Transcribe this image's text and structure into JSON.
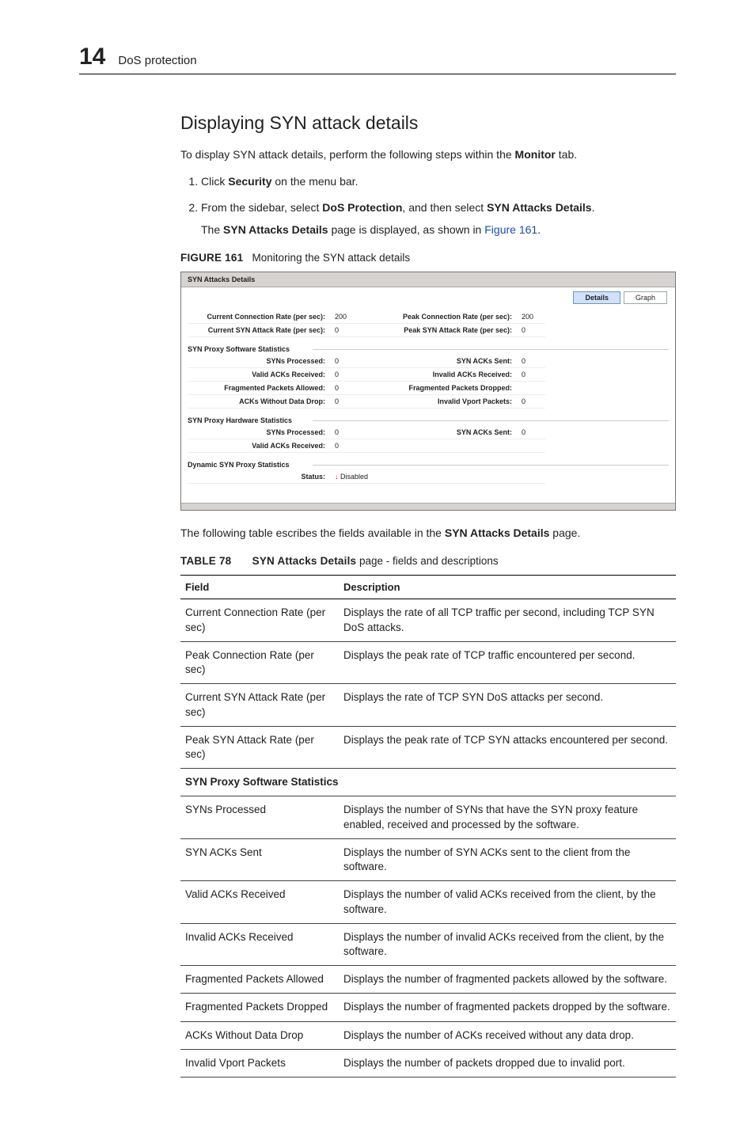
{
  "header": {
    "chapter_number": "14",
    "chapter_title": "DoS protection"
  },
  "section_title": "Displaying SYN attack details",
  "intro": {
    "pre": "To display SYN attack details, perform the following steps within the ",
    "bold": "Monitor",
    "post": " tab."
  },
  "steps": [
    {
      "pre": "Click ",
      "b1": "Security",
      "post": " on the menu bar."
    },
    {
      "pre": "From the sidebar, select ",
      "b1": "DoS Protection",
      "mid": ", and then select ",
      "b2": "SYN Attacks Details",
      "post": ".",
      "result_pre": "The ",
      "result_b": "SYN Attacks Details",
      "result_mid": " page is displayed, as shown in ",
      "result_link": "Figure 161",
      "result_post": "."
    }
  ],
  "figure": {
    "label": "FIGURE 161",
    "title": "Monitoring the SYN attack details"
  },
  "mock": {
    "title": "SYN Attacks Details",
    "tabs": {
      "details": "Details",
      "graph": "Graph"
    },
    "top_rows": [
      {
        "l1": "Current Connection Rate (per sec):",
        "v1": "200",
        "l2": "Peak Connection Rate (per sec):",
        "v2": "200"
      },
      {
        "l1": "Current SYN Attack Rate (per sec):",
        "v1": "0",
        "l2": "Peak SYN Attack Rate (per sec):",
        "v2": "0"
      }
    ],
    "group_soft": "SYN Proxy Software Statistics",
    "soft_rows": [
      {
        "l1": "SYNs Processed:",
        "v1": "0",
        "l2": "SYN ACKs Sent:",
        "v2": "0"
      },
      {
        "l1": "Valid ACKs Received:",
        "v1": "0",
        "l2": "Invalid ACKs Received:",
        "v2": "0"
      },
      {
        "l1": "Fragmented Packets Allowed:",
        "v1": "0",
        "l2": "Fragmented Packets Dropped:",
        "v2": ""
      },
      {
        "l1": "ACKs Without Data Drop:",
        "v1": "0",
        "l2": "Invalid Vport Packets:",
        "v2": "0"
      }
    ],
    "group_hard": "SYN Proxy Hardware Statistics",
    "hard_rows": [
      {
        "l1": "SYNs Processed:",
        "v1": "0",
        "l2": "SYN ACKs Sent:",
        "v2": "0"
      },
      {
        "l1": "Valid ACKs Received:",
        "v1": "0",
        "l2": "",
        "v2": ""
      }
    ],
    "group_dyn": "Dynamic SYN Proxy Statistics",
    "dyn_row": {
      "l1": "Status:",
      "v1": "Disabled"
    }
  },
  "post_figure": {
    "pre": "The following table escribes the fields available in the ",
    "b": "SYN Attacks Details",
    "post": " page."
  },
  "table_caption": {
    "label": "TABLE 78",
    "bold": "SYN Attacks Details",
    "tail": " page - fields and descriptions"
  },
  "table_headers": {
    "field": "Field",
    "desc": "Description"
  },
  "rows": [
    {
      "field": "Current Connection Rate (per sec)",
      "desc": "Displays the rate of all TCP traffic per second, including TCP SYN DoS attacks."
    },
    {
      "field": "Peak Connection Rate (per sec)",
      "desc": "Displays the peak rate of TCP traffic encountered per second."
    },
    {
      "field": "Current SYN Attack Rate (per sec)",
      "desc": "Displays the rate of TCP SYN DoS attacks per second."
    },
    {
      "field": "Peak SYN Attack Rate (per sec)",
      "desc": "Displays the peak rate of TCP SYN attacks encountered per second."
    },
    {
      "subhead": "SYN Proxy Software Statistics"
    },
    {
      "field": "SYNs Processed",
      "desc": "Displays the number of SYNs that have the SYN proxy feature enabled, received and processed by the software."
    },
    {
      "field": "SYN ACKs Sent",
      "desc": "Displays the number of SYN ACKs sent to the client from the software."
    },
    {
      "field": "Valid ACKs Received",
      "desc": "Displays the number of valid ACKs received from the client, by the software."
    },
    {
      "field": "Invalid ACKs Received",
      "desc": "Displays the number of invalid ACKs received from the client, by the software."
    },
    {
      "field": "Fragmented Packets Allowed",
      "desc": "Displays the number of fragmented packets allowed by the software."
    },
    {
      "field": "Fragmented Packets Dropped",
      "desc": "Displays the number of fragmented packets dropped by the software."
    },
    {
      "field": "ACKs Without Data Drop",
      "desc": "Displays the number of ACKs received without any data drop."
    },
    {
      "field": "Invalid Vport Packets",
      "desc": "Displays the number of packets dropped due to invalid port."
    }
  ]
}
